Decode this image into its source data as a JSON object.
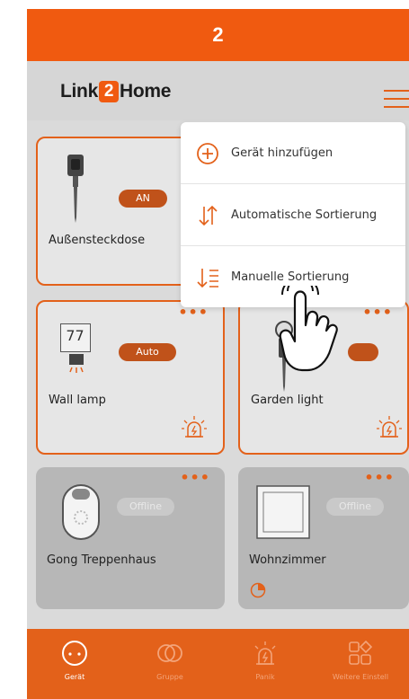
{
  "step_banner": "2",
  "header": {
    "logo_pre": "Link",
    "logo_two": "2",
    "logo_post": "Home"
  },
  "devices": [
    {
      "name": "Außensteckdose",
      "status": "AN"
    },
    {
      "name": "Wall lamp",
      "status": "Auto",
      "display_value": "77"
    },
    {
      "name": "Garden light",
      "status": ""
    },
    {
      "name": "Gong Treppenhaus",
      "status": "Offline"
    },
    {
      "name": "Wohnzimmer",
      "status": "Offline"
    }
  ],
  "menu": {
    "items": [
      {
        "label": "Gerät hinzufügen",
        "icon": "plus-circle-icon"
      },
      {
        "label": "Automatische Sortierung",
        "icon": "sort-arrows-icon"
      },
      {
        "label": "Manuelle Sortierung",
        "icon": "sort-list-icon"
      }
    ]
  },
  "tabbar": {
    "tabs": [
      {
        "label": "Gerät",
        "icon": "device-icon",
        "active": true
      },
      {
        "label": "Gruppe",
        "icon": "group-icon",
        "active": false
      },
      {
        "label": "Panik",
        "icon": "alarm-icon",
        "active": false
      },
      {
        "label": "Weitere Einstell",
        "icon": "grid-icon",
        "active": false
      }
    ]
  },
  "colors": {
    "accent": "#e3611a",
    "banner": "#f05a10"
  }
}
